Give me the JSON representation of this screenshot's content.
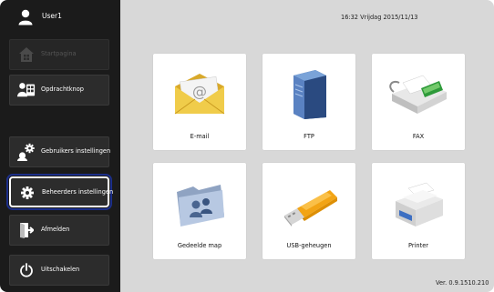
{
  "user": {
    "name": "User1",
    "icon": "user-icon"
  },
  "sidebar": {
    "items": [
      {
        "label": "Startpagina",
        "icon": "home-icon",
        "state": "disabled"
      },
      {
        "label": "Opdrachtknop",
        "icon": "job-button-icon",
        "state": "normal"
      },
      {
        "label": "Gebruikers instellingen",
        "icon": "gears-icon",
        "state": "normal"
      },
      {
        "label": "Beheerders instellingen",
        "icon": "gear-icon",
        "state": "selected"
      },
      {
        "label": "Afmelden",
        "icon": "logout-icon",
        "state": "normal"
      },
      {
        "label": "Uitschakelen",
        "icon": "power-icon",
        "state": "normal"
      }
    ]
  },
  "header": {
    "datetime": "16:32 Vrijdag 2015/11/13"
  },
  "tiles": [
    {
      "label": "E-mail",
      "icon": "email-envelope-icon"
    },
    {
      "label": "FTP",
      "icon": "ftp-server-icon"
    },
    {
      "label": "FAX",
      "icon": "fax-machine-icon"
    },
    {
      "label": "Gedeelde map",
      "icon": "shared-folder-icon"
    },
    {
      "label": "USB-geheugen",
      "icon": "usb-drive-icon"
    },
    {
      "label": "Printer",
      "icon": "printer-icon"
    }
  ],
  "footer": {
    "version": "Ver. 0.9.1510.210"
  },
  "colors": {
    "sidebar_bg": "#1b1b1b",
    "main_bg": "#d8d8d8",
    "selected_outline": "#1c2f8a"
  }
}
